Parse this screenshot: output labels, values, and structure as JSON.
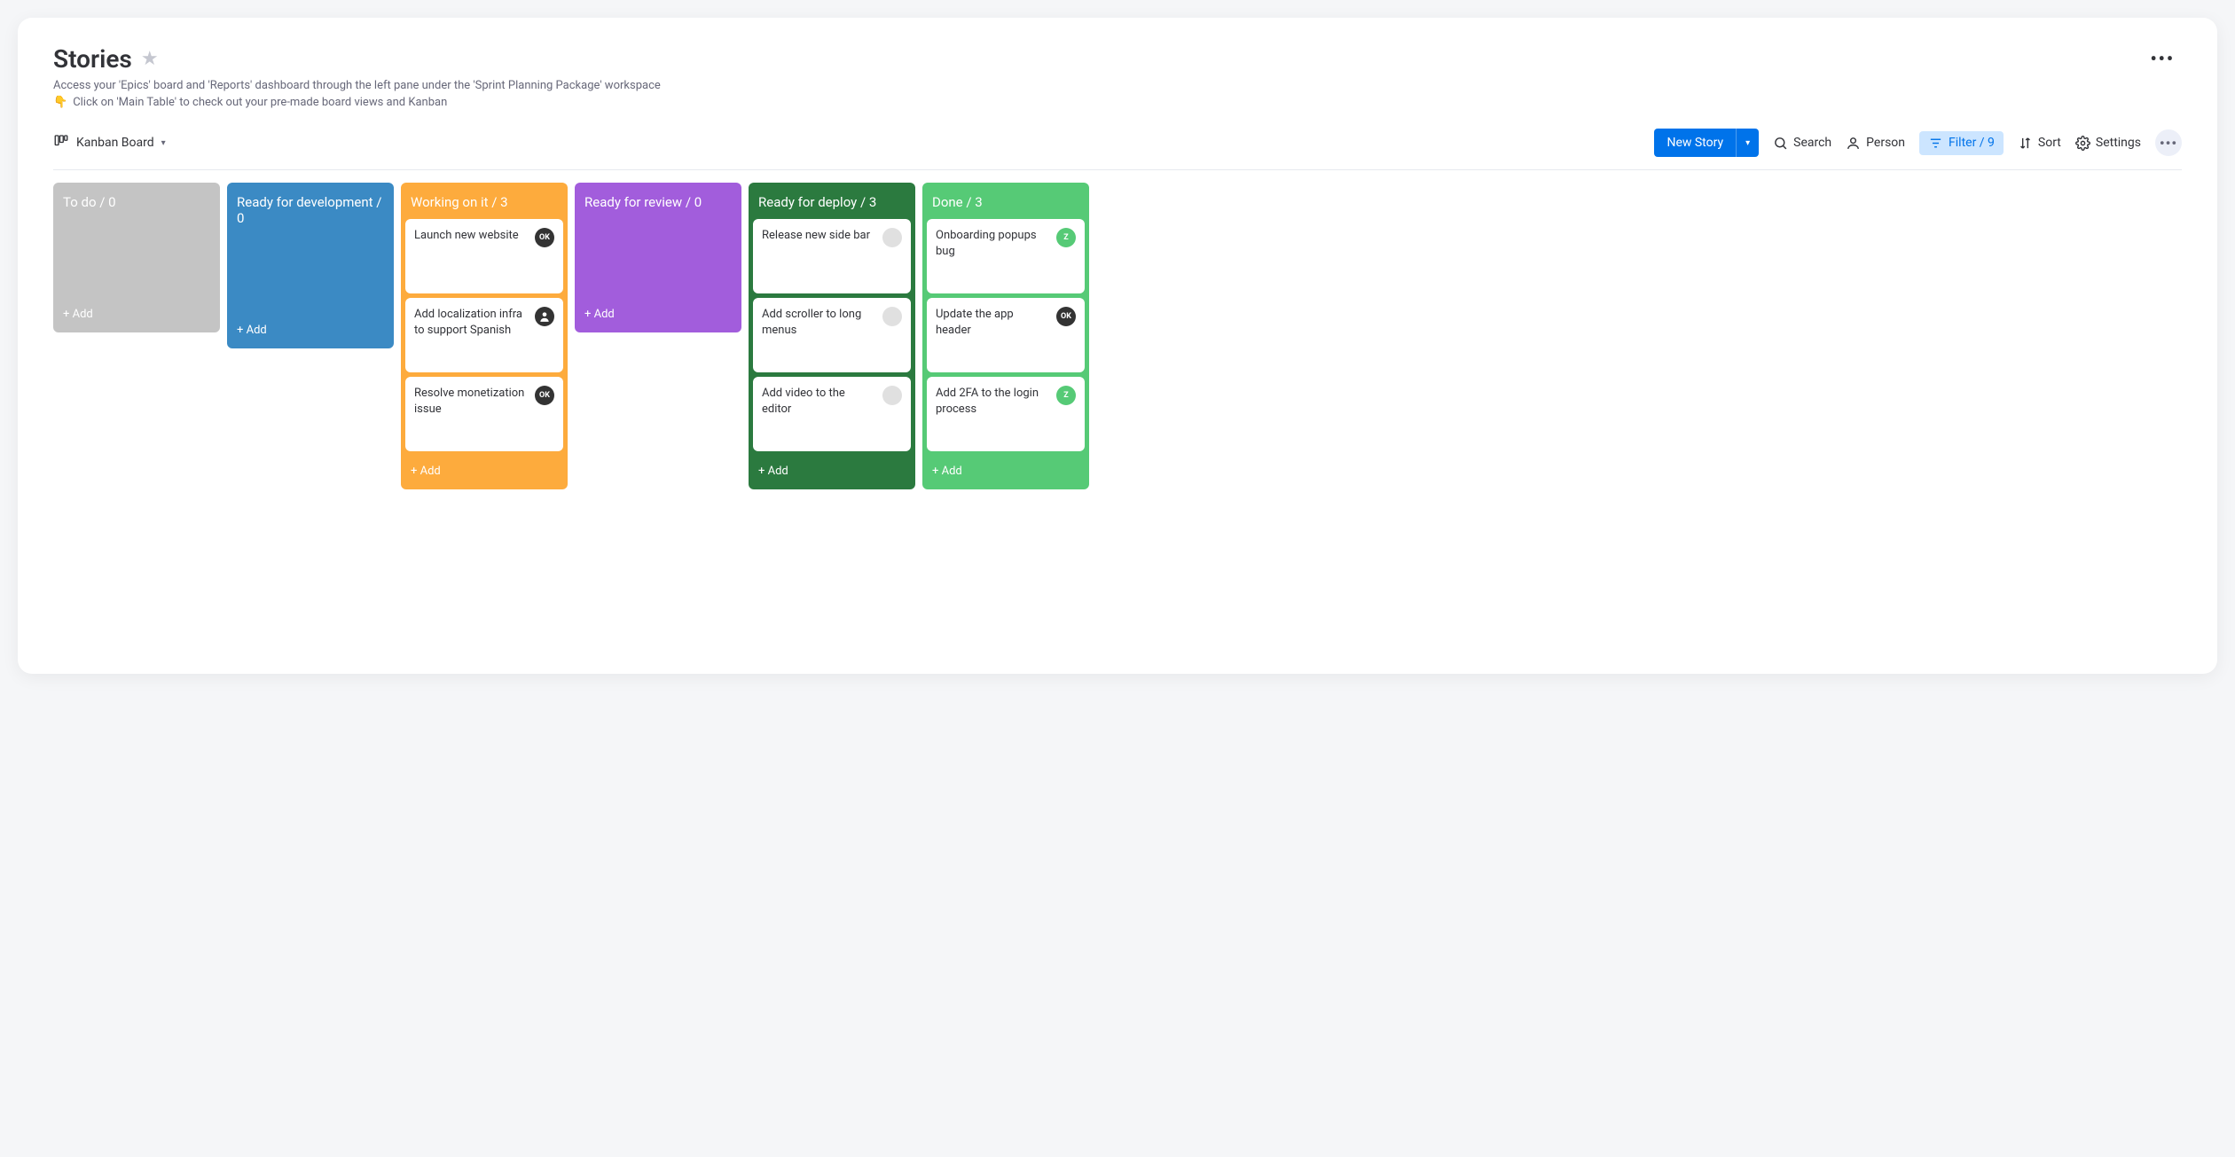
{
  "header": {
    "title": "Stories",
    "subtitle": "Access your 'Epics' board and 'Reports' dashboard through the left pane under the 'Sprint Planning Package' workspace",
    "hint_emoji": "👇",
    "hint": "Click on 'Main Table' to check out your pre-made board views and Kanban"
  },
  "view": {
    "label": "Kanban Board"
  },
  "toolbar": {
    "new_story": "New Story",
    "search": "Search",
    "person": "Person",
    "filter": "Filter / 9",
    "sort": "Sort",
    "settings": "Settings"
  },
  "columns": [
    {
      "title": "To do",
      "count": 0,
      "color": "#c4c4c4",
      "add_label": "+ Add",
      "cards": []
    },
    {
      "title": "Ready for development",
      "count": 0,
      "color": "#3b8ac4",
      "add_label": "+ Add",
      "cards": []
    },
    {
      "title": "Working on it",
      "count": 3,
      "color": "#fdab3d",
      "add_label": "+ Add",
      "cards": [
        {
          "title": "Launch new website",
          "avatar_type": "ok",
          "avatar_label": "OK"
        },
        {
          "title": "Add localization infra to support Spanish",
          "avatar_type": "user",
          "avatar_label": ""
        },
        {
          "title": "Resolve monetization issue",
          "avatar_type": "ok",
          "avatar_label": "OK"
        }
      ]
    },
    {
      "title": "Ready for review",
      "count": 0,
      "color": "#a25ddc",
      "add_label": "+ Add",
      "cards": []
    },
    {
      "title": "Ready for deploy",
      "count": 3,
      "color": "#2b7a3f",
      "add_label": "+ Add",
      "cards": [
        {
          "title": "Release new side bar",
          "avatar_type": "blank",
          "avatar_label": ""
        },
        {
          "title": "Add scroller to long menus",
          "avatar_type": "blank",
          "avatar_label": ""
        },
        {
          "title": "Add video to the editor",
          "avatar_type": "blank",
          "avatar_label": ""
        }
      ]
    },
    {
      "title": "Done",
      "count": 3,
      "color": "#56ca76",
      "add_label": "+ Add",
      "cards": [
        {
          "title": "Onboarding popups bug",
          "avatar_type": "z",
          "avatar_label": "Z"
        },
        {
          "title": "Update the app header",
          "avatar_type": "ok",
          "avatar_label": "OK"
        },
        {
          "title": "Add 2FA to the login process",
          "avatar_type": "z",
          "avatar_label": "Z"
        }
      ]
    }
  ]
}
